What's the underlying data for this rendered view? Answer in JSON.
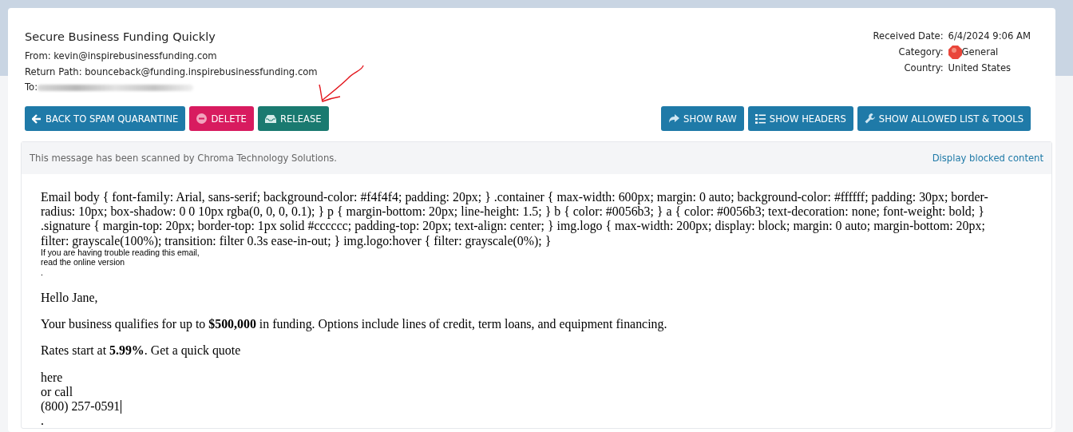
{
  "message": {
    "subject": "Secure Business Funding Quickly",
    "from": "From: kevin@inspirebusinessfunding.com",
    "return_path": "Return Path: bounceback@funding.inspirebusinessfunding.com",
    "to_label": "To:"
  },
  "meta": [
    {
      "label": "Received Date:",
      "value": "6/4/2024 9:06 AM",
      "kind": "text"
    },
    {
      "label": "Category:",
      "value": "General",
      "kind": "category"
    },
    {
      "label": "Country:",
      "value": "United States",
      "kind": "text"
    }
  ],
  "actions_left": [
    {
      "label": "BACK TO SPAM QUARANTINE",
      "kind": "back"
    },
    {
      "label": "DELETE",
      "kind": "delete"
    },
    {
      "label": "RELEASE",
      "kind": "release"
    }
  ],
  "actions_right": [
    {
      "label": "SHOW RAW",
      "kind": "raw"
    },
    {
      "label": "SHOW HEADERS",
      "kind": "headers"
    },
    {
      "label": "SHOW ALLOWED LIST & TOOLS",
      "kind": "tools"
    }
  ],
  "notice": {
    "text": "This message has been scanned by Chroma Technology Solutions.",
    "link": "Display blocked content"
  },
  "body": {
    "css_text": "Email body { font-family: Arial, sans-serif; background-color: #f4f4f4; padding: 20px; } .container { max-width: 600px; margin: 0 auto; background-color: #ffffff; padding: 30px; border-radius: 10px; box-shadow: 0 0 10px rgba(0, 0, 0, 0.1); } p { margin-bottom: 20px; line-height: 1.5; } b { color: #0056b3; } a { color: #0056b3; text-decoration: none; font-weight: bold; } .signature { margin-top: 20px; border-top: 1px solid #cccccc; padding-top: 20px; text-align: center; } img.logo { max-width: 200px; display: block; margin: 0 auto; margin-bottom: 20px; filter: grayscale(100%); transition: filter 0.3s ease-in-out; } img.logo:hover { filter: grayscale(0%); }",
    "small_lines": [
      "If you are having trouble reading this email,",
      "read the online version",
      "."
    ],
    "greeting": "Hello Jane,",
    "paragraphs": [
      "Your business qualifies for up to **$500,000** in funding. Options include lines of credit, term loans, and equipment financing.",
      "Rates start at **5.99%**. Get a quick quote"
    ],
    "contact_lines": [
      "here",
      "or call",
      "(800) 257-0591"
    ],
    "trailing": "."
  }
}
